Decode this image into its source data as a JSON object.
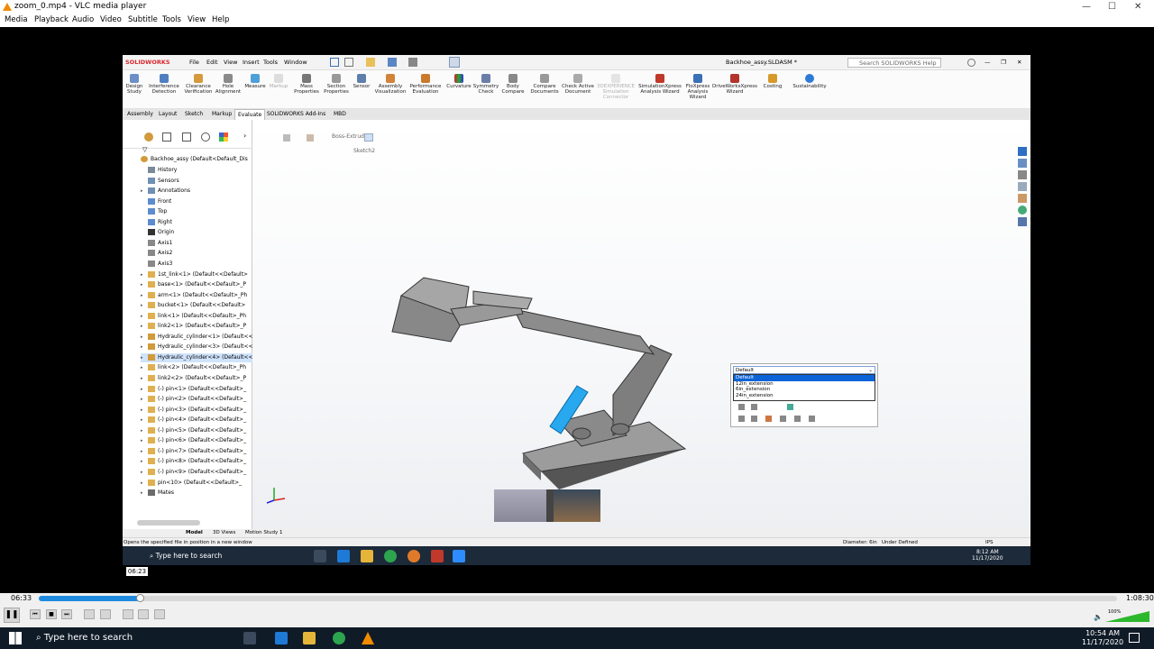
{
  "vlc": {
    "title": "zoom_0.mp4 - VLC media player",
    "window_controls": {
      "minimize": "—",
      "maximize": "☐",
      "close": "✕"
    },
    "menu": [
      "Media",
      "Playback",
      "Audio",
      "Video",
      "Subtitle",
      "Tools",
      "View",
      "Help"
    ],
    "controls": {
      "elapsed": "06:33",
      "total": "1:08:30",
      "progress_fraction": 0.094,
      "tooltip_time": "06:23",
      "volume": "100%"
    }
  },
  "solidworks": {
    "logo": "SOLIDWORKS",
    "menu": [
      "File",
      "Edit",
      "View",
      "Insert",
      "Tools",
      "Window"
    ],
    "document_title": "Backhoe_assy.SLDASM *",
    "search_placeholder": "Search SOLIDWORKS Help",
    "ribbon": [
      {
        "label": "Design Study",
        "icon": "design-study-icon"
      },
      {
        "label": "Interference Detection",
        "icon": "interference-icon"
      },
      {
        "label": "Clearance Verification",
        "icon": "clearance-icon"
      },
      {
        "label": "Hole Alignment",
        "icon": "hole-alignment-icon"
      },
      {
        "label": "Measure",
        "icon": "measure-icon"
      },
      {
        "label": "Markup",
        "icon": "markup-icon"
      },
      {
        "label": "Mass Properties",
        "icon": "mass-properties-icon"
      },
      {
        "label": "Section Properties",
        "icon": "section-properties-icon"
      },
      {
        "label": "Sensor",
        "icon": "sensor-icon"
      },
      {
        "label": "Assembly Visualization",
        "icon": "assembly-visualization-icon"
      },
      {
        "label": "Performance Evaluation",
        "icon": "performance-icon"
      },
      {
        "label": "Curvature",
        "icon": "curvature-icon"
      },
      {
        "label": "Symmetry Check",
        "icon": "symmetry-icon"
      },
      {
        "label": "Body Compare",
        "icon": "body-compare-icon"
      },
      {
        "label": "Compare Documents",
        "icon": "compare-documents-icon"
      },
      {
        "label": "Check Active Document",
        "icon": "check-document-icon"
      },
      {
        "label": "3DEXPERIENCE Simulation Connector",
        "icon": "simulation-connector-icon"
      },
      {
        "label": "SimulationXpress Analysis Wizard",
        "icon": "simulationxpress-icon"
      },
      {
        "label": "FloXpress Analysis Wizard",
        "icon": "floxpress-icon"
      },
      {
        "label": "DriveWorksXpress Wizard",
        "icon": "driveworks-icon"
      },
      {
        "label": "Costing",
        "icon": "costing-icon"
      },
      {
        "label": "Sustainability",
        "icon": "sustainability-icon"
      }
    ],
    "command_tabs": [
      "Assembly",
      "Layout",
      "Sketch",
      "Markup",
      "Evaluate",
      "SOLIDWORKS Add-Ins",
      "MBD"
    ],
    "active_tab": "Evaluate",
    "breadcrumb": {
      "feature": "Boss-Extrude2",
      "sketch": "Sketch2"
    },
    "tree": {
      "root": "Backhoe_assy  (Default<Default_Dis",
      "items": [
        {
          "label": "History",
          "icon": "history-icon",
          "arrow": false
        },
        {
          "label": "Sensors",
          "icon": "sensors-icon",
          "arrow": false
        },
        {
          "label": "Annotations",
          "icon": "annotations-icon",
          "arrow": true
        },
        {
          "label": "Front",
          "icon": "plane-icon",
          "arrow": false
        },
        {
          "label": "Top",
          "icon": "plane-icon",
          "arrow": false
        },
        {
          "label": "Right",
          "icon": "plane-icon",
          "arrow": false
        },
        {
          "label": "Origin",
          "icon": "origin-icon",
          "arrow": false
        },
        {
          "label": "Axis1",
          "icon": "axis-icon",
          "arrow": false
        },
        {
          "label": "Axis2",
          "icon": "axis-icon",
          "arrow": false
        },
        {
          "label": "Axis3",
          "icon": "axis-icon",
          "arrow": false
        },
        {
          "label": "1st_link<1> (Default<<Default>",
          "icon": "part-icon",
          "arrow": true
        },
        {
          "label": "base<1> (Default<<Default>_P",
          "icon": "part-icon",
          "arrow": true
        },
        {
          "label": "arm<1> (Default<<Default>_Ph",
          "icon": "part-icon",
          "arrow": true
        },
        {
          "label": "bucket<1> (Default<<Default>",
          "icon": "part-icon",
          "arrow": true
        },
        {
          "label": "link<1> (Default<<Default>_Ph",
          "icon": "part-icon",
          "arrow": true
        },
        {
          "label": "link2<1> (Default<<Default>_P",
          "icon": "part-icon",
          "arrow": true
        },
        {
          "label": "Hydraulic_cylinder<1> (Default<<D",
          "icon": "assembly-icon",
          "arrow": true
        },
        {
          "label": "Hydraulic_cylinder<3> (Default<<D",
          "icon": "assembly-icon",
          "arrow": true
        },
        {
          "label": "Hydraulic_cylinder<4> (Default<<D",
          "icon": "assembly-icon",
          "arrow": true,
          "selected": true
        },
        {
          "label": "link<2> (Default<<Default>_Ph",
          "icon": "part-icon",
          "arrow": true
        },
        {
          "label": "link2<2> (Default<<Default>_P",
          "icon": "part-icon",
          "arrow": true
        },
        {
          "label": "(-) pin<1> (Default<<Default>_",
          "icon": "part-icon",
          "arrow": true
        },
        {
          "label": "(-) pin<2> (Default<<Default>_",
          "icon": "part-icon",
          "arrow": true
        },
        {
          "label": "(-) pin<3> (Default<<Default>_",
          "icon": "part-icon",
          "arrow": true
        },
        {
          "label": "(-) pin<4> (Default<<Default>_",
          "icon": "part-icon",
          "arrow": true
        },
        {
          "label": "(-) pin<5> (Default<<Default>_",
          "icon": "part-icon",
          "arrow": true
        },
        {
          "label": "(-) pin<6> (Default<<Default>_",
          "icon": "part-icon",
          "arrow": true
        },
        {
          "label": "(-) pin<7> (Default<<Default>_",
          "icon": "part-icon",
          "arrow": true
        },
        {
          "label": "(-) pin<8> (Default<<Default>_",
          "icon": "part-icon",
          "arrow": true
        },
        {
          "label": "(-) pin<9> (Default<<Default>_",
          "icon": "part-icon",
          "arrow": true
        },
        {
          "label": "pin<10> (Default<<Default>_",
          "icon": "part-icon",
          "arrow": true
        },
        {
          "label": "Mates",
          "icon": "mates-icon",
          "arrow": true
        }
      ]
    },
    "config_popup": {
      "selected": "Default",
      "options": [
        "Default",
        "12in_extension",
        "6in_extension",
        "24in_extension"
      ],
      "highlighted": "Default"
    },
    "bottom_tabs": [
      "Model",
      "3D Views",
      "Motion Study 1"
    ],
    "active_bottom_tab": "Model",
    "status_left": "Opens the specified file in position in a new window",
    "status_diameter": "Diameter: 6in",
    "status_defined": "Under Defined",
    "status_units": "IPS"
  },
  "inner_taskbar": {
    "search_placeholder": "Type here to search",
    "time": "8:12 AM",
    "date": "11/17/2020"
  },
  "outer_taskbar": {
    "search_placeholder": "Type here to search",
    "time": "10:54 AM",
    "date": "11/17/2020"
  },
  "colors": {
    "accent_blue": "#0a64d8",
    "cylinder_blue": "#28a8ee",
    "sw_red": "#d9272e",
    "vlc_orange": "#f08a00",
    "progress_blue": "#1f8be0"
  }
}
